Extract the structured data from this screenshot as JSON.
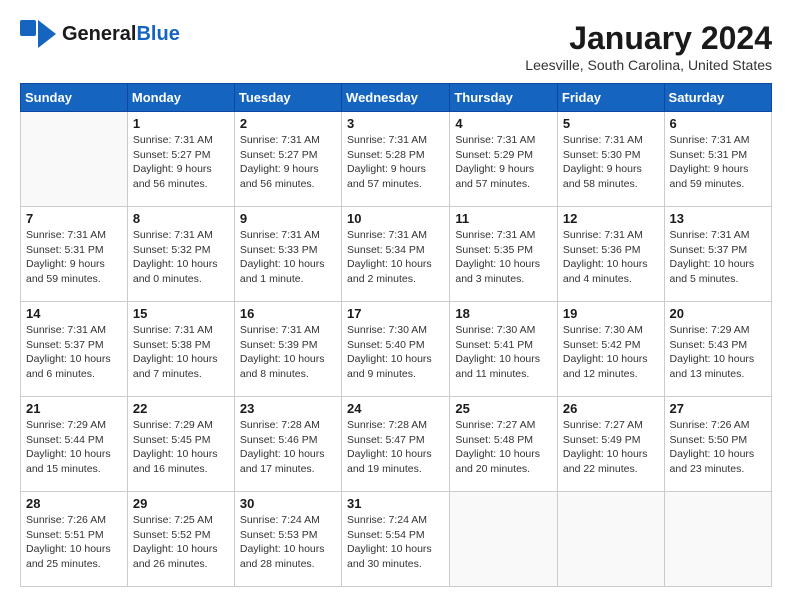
{
  "header": {
    "logo_general": "General",
    "logo_blue": "Blue",
    "month_title": "January 2024",
    "location": "Leesville, South Carolina, United States"
  },
  "calendar": {
    "weekdays": [
      "Sunday",
      "Monday",
      "Tuesday",
      "Wednesday",
      "Thursday",
      "Friday",
      "Saturday"
    ],
    "weeks": [
      [
        {
          "day": "",
          "info": ""
        },
        {
          "day": "1",
          "info": "Sunrise: 7:31 AM\nSunset: 5:27 PM\nDaylight: 9 hours\nand 56 minutes."
        },
        {
          "day": "2",
          "info": "Sunrise: 7:31 AM\nSunset: 5:27 PM\nDaylight: 9 hours\nand 56 minutes."
        },
        {
          "day": "3",
          "info": "Sunrise: 7:31 AM\nSunset: 5:28 PM\nDaylight: 9 hours\nand 57 minutes."
        },
        {
          "day": "4",
          "info": "Sunrise: 7:31 AM\nSunset: 5:29 PM\nDaylight: 9 hours\nand 57 minutes."
        },
        {
          "day": "5",
          "info": "Sunrise: 7:31 AM\nSunset: 5:30 PM\nDaylight: 9 hours\nand 58 minutes."
        },
        {
          "day": "6",
          "info": "Sunrise: 7:31 AM\nSunset: 5:31 PM\nDaylight: 9 hours\nand 59 minutes."
        }
      ],
      [
        {
          "day": "7",
          "info": "Sunrise: 7:31 AM\nSunset: 5:31 PM\nDaylight: 9 hours\nand 59 minutes."
        },
        {
          "day": "8",
          "info": "Sunrise: 7:31 AM\nSunset: 5:32 PM\nDaylight: 10 hours\nand 0 minutes."
        },
        {
          "day": "9",
          "info": "Sunrise: 7:31 AM\nSunset: 5:33 PM\nDaylight: 10 hours\nand 1 minute."
        },
        {
          "day": "10",
          "info": "Sunrise: 7:31 AM\nSunset: 5:34 PM\nDaylight: 10 hours\nand 2 minutes."
        },
        {
          "day": "11",
          "info": "Sunrise: 7:31 AM\nSunset: 5:35 PM\nDaylight: 10 hours\nand 3 minutes."
        },
        {
          "day": "12",
          "info": "Sunrise: 7:31 AM\nSunset: 5:36 PM\nDaylight: 10 hours\nand 4 minutes."
        },
        {
          "day": "13",
          "info": "Sunrise: 7:31 AM\nSunset: 5:37 PM\nDaylight: 10 hours\nand 5 minutes."
        }
      ],
      [
        {
          "day": "14",
          "info": "Sunrise: 7:31 AM\nSunset: 5:37 PM\nDaylight: 10 hours\nand 6 minutes."
        },
        {
          "day": "15",
          "info": "Sunrise: 7:31 AM\nSunset: 5:38 PM\nDaylight: 10 hours\nand 7 minutes."
        },
        {
          "day": "16",
          "info": "Sunrise: 7:31 AM\nSunset: 5:39 PM\nDaylight: 10 hours\nand 8 minutes."
        },
        {
          "day": "17",
          "info": "Sunrise: 7:30 AM\nSunset: 5:40 PM\nDaylight: 10 hours\nand 9 minutes."
        },
        {
          "day": "18",
          "info": "Sunrise: 7:30 AM\nSunset: 5:41 PM\nDaylight: 10 hours\nand 11 minutes."
        },
        {
          "day": "19",
          "info": "Sunrise: 7:30 AM\nSunset: 5:42 PM\nDaylight: 10 hours\nand 12 minutes."
        },
        {
          "day": "20",
          "info": "Sunrise: 7:29 AM\nSunset: 5:43 PM\nDaylight: 10 hours\nand 13 minutes."
        }
      ],
      [
        {
          "day": "21",
          "info": "Sunrise: 7:29 AM\nSunset: 5:44 PM\nDaylight: 10 hours\nand 15 minutes."
        },
        {
          "day": "22",
          "info": "Sunrise: 7:29 AM\nSunset: 5:45 PM\nDaylight: 10 hours\nand 16 minutes."
        },
        {
          "day": "23",
          "info": "Sunrise: 7:28 AM\nSunset: 5:46 PM\nDaylight: 10 hours\nand 17 minutes."
        },
        {
          "day": "24",
          "info": "Sunrise: 7:28 AM\nSunset: 5:47 PM\nDaylight: 10 hours\nand 19 minutes."
        },
        {
          "day": "25",
          "info": "Sunrise: 7:27 AM\nSunset: 5:48 PM\nDaylight: 10 hours\nand 20 minutes."
        },
        {
          "day": "26",
          "info": "Sunrise: 7:27 AM\nSunset: 5:49 PM\nDaylight: 10 hours\nand 22 minutes."
        },
        {
          "day": "27",
          "info": "Sunrise: 7:26 AM\nSunset: 5:50 PM\nDaylight: 10 hours\nand 23 minutes."
        }
      ],
      [
        {
          "day": "28",
          "info": "Sunrise: 7:26 AM\nSunset: 5:51 PM\nDaylight: 10 hours\nand 25 minutes."
        },
        {
          "day": "29",
          "info": "Sunrise: 7:25 AM\nSunset: 5:52 PM\nDaylight: 10 hours\nand 26 minutes."
        },
        {
          "day": "30",
          "info": "Sunrise: 7:24 AM\nSunset: 5:53 PM\nDaylight: 10 hours\nand 28 minutes."
        },
        {
          "day": "31",
          "info": "Sunrise: 7:24 AM\nSunset: 5:54 PM\nDaylight: 10 hours\nand 30 minutes."
        },
        {
          "day": "",
          "info": ""
        },
        {
          "day": "",
          "info": ""
        },
        {
          "day": "",
          "info": ""
        }
      ]
    ]
  }
}
